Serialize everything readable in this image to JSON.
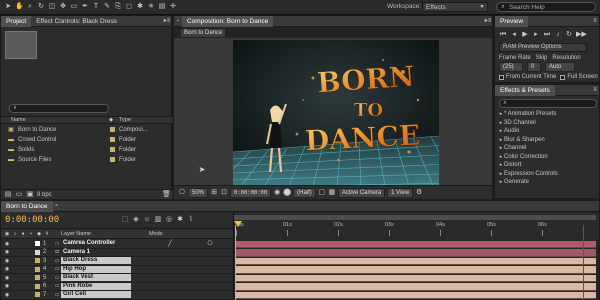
{
  "toolbar": {
    "workspace_label": "Workspace:",
    "workspace_value": "Effects",
    "search_placeholder": "Search Help",
    "tool_icons": [
      "selection-tool-icon",
      "hand-tool-icon",
      "zoom-tool-icon",
      "rotate-tool-icon",
      "camera-tool-icon",
      "pan-behind-icon",
      "rectangle-tool-icon",
      "pen-tool-icon",
      "text-tool-icon",
      "brush-tool-icon",
      "clone-tool-icon",
      "eraser-tool-icon",
      "roto-brush-icon",
      "puppet-tool-icon",
      "align-icon",
      "3d-axis-icon"
    ]
  },
  "project_panel": {
    "tab_project": "Project",
    "tab_effect_controls": "Effect Controls: Black Dress",
    "search_placeholder": "",
    "col_name": "Name",
    "col_type": "Type",
    "items": [
      {
        "name": "Born to Dance",
        "type": "Composi...",
        "color": "#c7b26a",
        "icon": "composition-icon"
      },
      {
        "name": "Crowd Control",
        "type": "Folder",
        "color": "#c7b26a",
        "icon": "folder-icon"
      },
      {
        "name": "Solids",
        "type": "Folder",
        "color": "#c7b26a",
        "icon": "folder-icon"
      },
      {
        "name": "Source Files",
        "type": "Folder",
        "color": "#c7b26a",
        "icon": "folder-icon"
      }
    ],
    "bit_depth": "8 bpc"
  },
  "comp_panel": {
    "tab_label": "Composition: Born to Dance",
    "comp_button": "Born to Dance",
    "zoom": "50%",
    "timecode": "0:00:00:00",
    "resolution": "(Half)",
    "camera": "Active Camera",
    "views": "1 View",
    "title_lines": [
      "BORN",
      "TO",
      "DANCE"
    ]
  },
  "preview_panel": {
    "tab": "Preview",
    "ram_preview": "RAM Preview Options",
    "frame_rate_label": "Frame Rate",
    "skip_label": "Skip",
    "resolution_label": "Resolution",
    "frame_rate_value": "(25)",
    "skip_value": "0",
    "resolution_value": "Auto",
    "from_current_time": "From Current Time",
    "full_screen": "Full Screen"
  },
  "effects_panel": {
    "tab": "Effects & Presets",
    "search_placeholder": "",
    "categories": [
      "* Animation Presets",
      "3D Channel",
      "Audio",
      "Blur & Sharpen",
      "Channel",
      "Color Correction",
      "Distort",
      "Expression Controls",
      "Generate"
    ]
  },
  "timeline": {
    "tab": "Born to Dance",
    "timecode": "0:00:00:00",
    "col_layer_name": "Layer Name",
    "col_mode": "Mode",
    "ruler": [
      "0s",
      "01s",
      "02s",
      "03s",
      "04s",
      "05s",
      "06s"
    ],
    "layers": [
      {
        "num": "1",
        "name": "Camrea Controller",
        "color": "#ffffff",
        "bar": "#b15a69",
        "type": "null"
      },
      {
        "num": "2",
        "name": "Camera 1",
        "color": "#d8d8d8",
        "bar": "#9c5a66",
        "type": "camera"
      },
      {
        "num": "3",
        "name": "Black Dress",
        "color": "#c7b26a",
        "bar": "#d9b9a3",
        "type": "footage"
      },
      {
        "num": "4",
        "name": "Hip Hop",
        "color": "#c7b26a",
        "bar": "#d9b9a3",
        "type": "footage"
      },
      {
        "num": "5",
        "name": "Black Vest",
        "color": "#c7b26a",
        "bar": "#d9b9a3",
        "type": "footage"
      },
      {
        "num": "6",
        "name": "Pink Robe",
        "color": "#c7b26a",
        "bar": "#d9b9a3",
        "type": "footage"
      },
      {
        "num": "7",
        "name": "Girl Cell",
        "color": "#c7b26a",
        "bar": "#d9b9a3",
        "type": "footage"
      }
    ]
  }
}
